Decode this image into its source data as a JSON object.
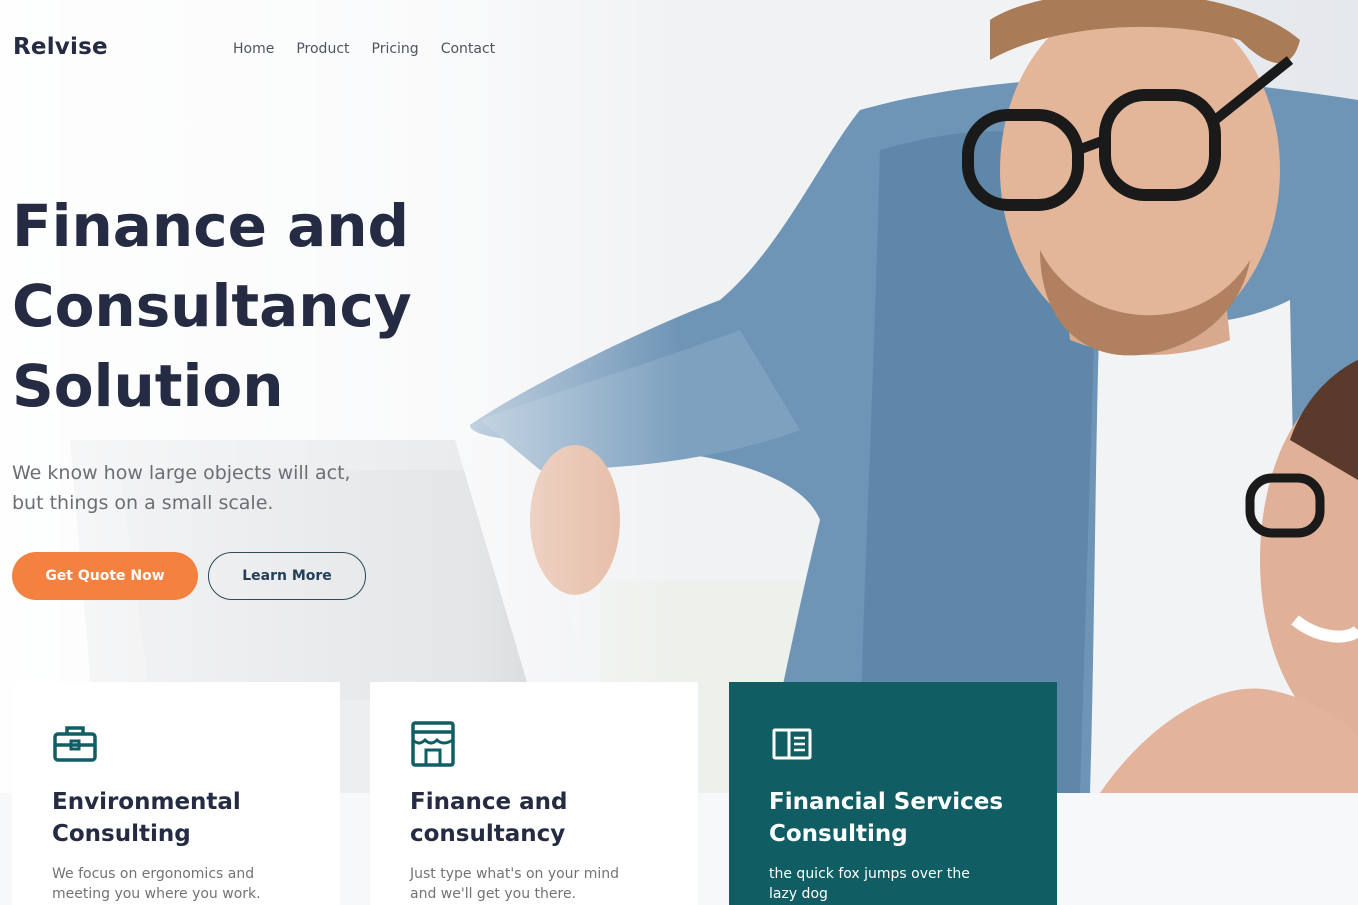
{
  "brand": {
    "name": "Relvise"
  },
  "nav": {
    "items": [
      "Home",
      "Product",
      "Pricing",
      "Contact"
    ]
  },
  "hero": {
    "title_line1": "Finance and",
    "title_line2": "Consultancy",
    "title_line3": "Solution",
    "subtitle_line1": "We know how large objects will act,",
    "subtitle_line2": "but things on a small scale.",
    "primary_button": "Get Quote Now",
    "secondary_button": "Learn More"
  },
  "cards": [
    {
      "title_line1": "Environmental",
      "title_line2": "Consulting",
      "text_line1": "We focus on ergonomics and",
      "text_line2": "meeting you where you work.",
      "icon": "briefcase-icon"
    },
    {
      "title_line1": "Finance and",
      "title_line2": "consultancy",
      "text_line1": "Just type what's on your mind",
      "text_line2": "and we'll get you there.",
      "icon": "storefront-icon"
    },
    {
      "title_line1": "Financial Services",
      "title_line2": "Consulting",
      "text_line1": "the quick fox jumps over the",
      "text_line2": "lazy dog",
      "icon": "book-open-icon"
    }
  ],
  "colors": {
    "accent": "#f4813f",
    "dark_text": "#252b42",
    "teal": "#105d64",
    "outline": "#2a4a5b"
  }
}
